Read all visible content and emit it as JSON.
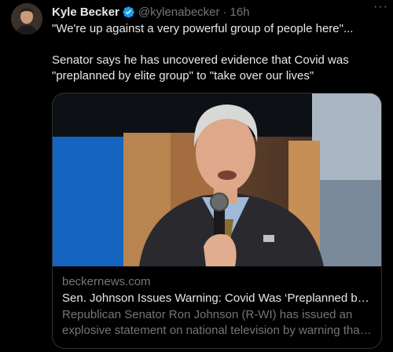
{
  "author": {
    "name": "Kyle Becker",
    "handle": "@kylenabecker",
    "separator": "·",
    "time": "16h",
    "avatar_icon": "user-avatar",
    "verified_icon": "verified-badge-icon",
    "verified_color": "#1d9bf0"
  },
  "more_label": "···",
  "tweet": {
    "line1": "\"We're up against a very powerful group of people here\"...",
    "line2": "Senator says he has uncovered evidence that Covid was \"preplanned by elite group\" to \"take over our lives\""
  },
  "card": {
    "domain": "beckernews.com",
    "title": "Sen. Johnson Issues Warning: Covid Was ‘Preplanned by Elite Group’",
    "description": "Republican Senator Ron Johnson (R-WI) has issued an explosive statement on national television by warning that the pandemic was preplanned."
  },
  "colors": {
    "background": "#000000",
    "text": "#e7e9ea",
    "secondary": "#71767b",
    "border": "#2f3336"
  }
}
